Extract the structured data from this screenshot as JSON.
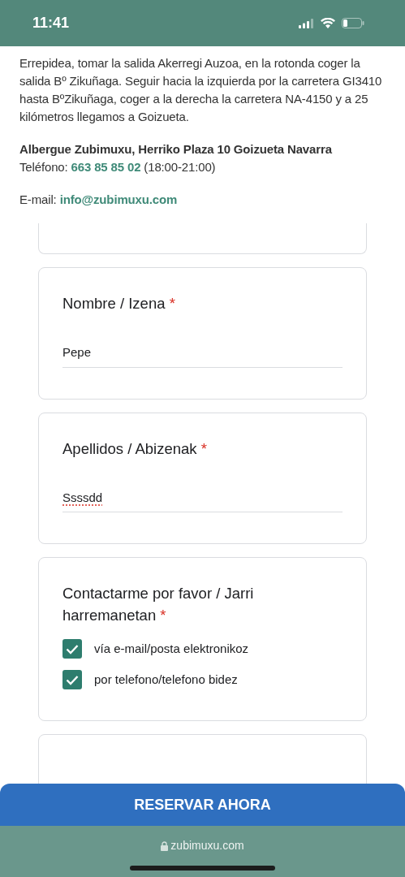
{
  "status_bar": {
    "time": "11:41"
  },
  "intro": {
    "paragraph": "Errepidea, tomar la salida Akerregi Auzoa, en la rotonda coger la salida Bº Zikuñaga. Seguir hacia la izquierda por la carretera GI3410 hasta BºZikuñaga, coger a la derecha la carretera NA-4150 y a 25 kilómetros llegamos a Goizueta.",
    "address": "Albergue Zubimuxu, Herriko Plaza 10 Goizueta Navarra",
    "phone_label": "Teléfono:",
    "phone": "663 85 85 02",
    "hours": "(18:00-21:00)",
    "email_label": "E-mail:",
    "email": "info@zubimuxu.com"
  },
  "questions": [
    {
      "kind": "text",
      "title": "Nombre / Izena",
      "required_mark": "*",
      "value": "Pepe",
      "misspelled": false
    },
    {
      "kind": "text",
      "title": "Apellidos / Abizenak",
      "required_mark": "*",
      "value": "Ssssdd",
      "misspelled": true
    },
    {
      "kind": "checkboxes",
      "title": "Contactarme por favor / Jarri harremanetan",
      "required_mark": "*",
      "options": [
        {
          "label": "vía e-mail/posta elektronikoz",
          "checked": true
        },
        {
          "label": "por telefono/telefono bidez",
          "checked": true
        }
      ]
    }
  ],
  "reserve_button": "RESERVAR AHORA",
  "url_bar": {
    "address": "zubimuxu.com"
  }
}
